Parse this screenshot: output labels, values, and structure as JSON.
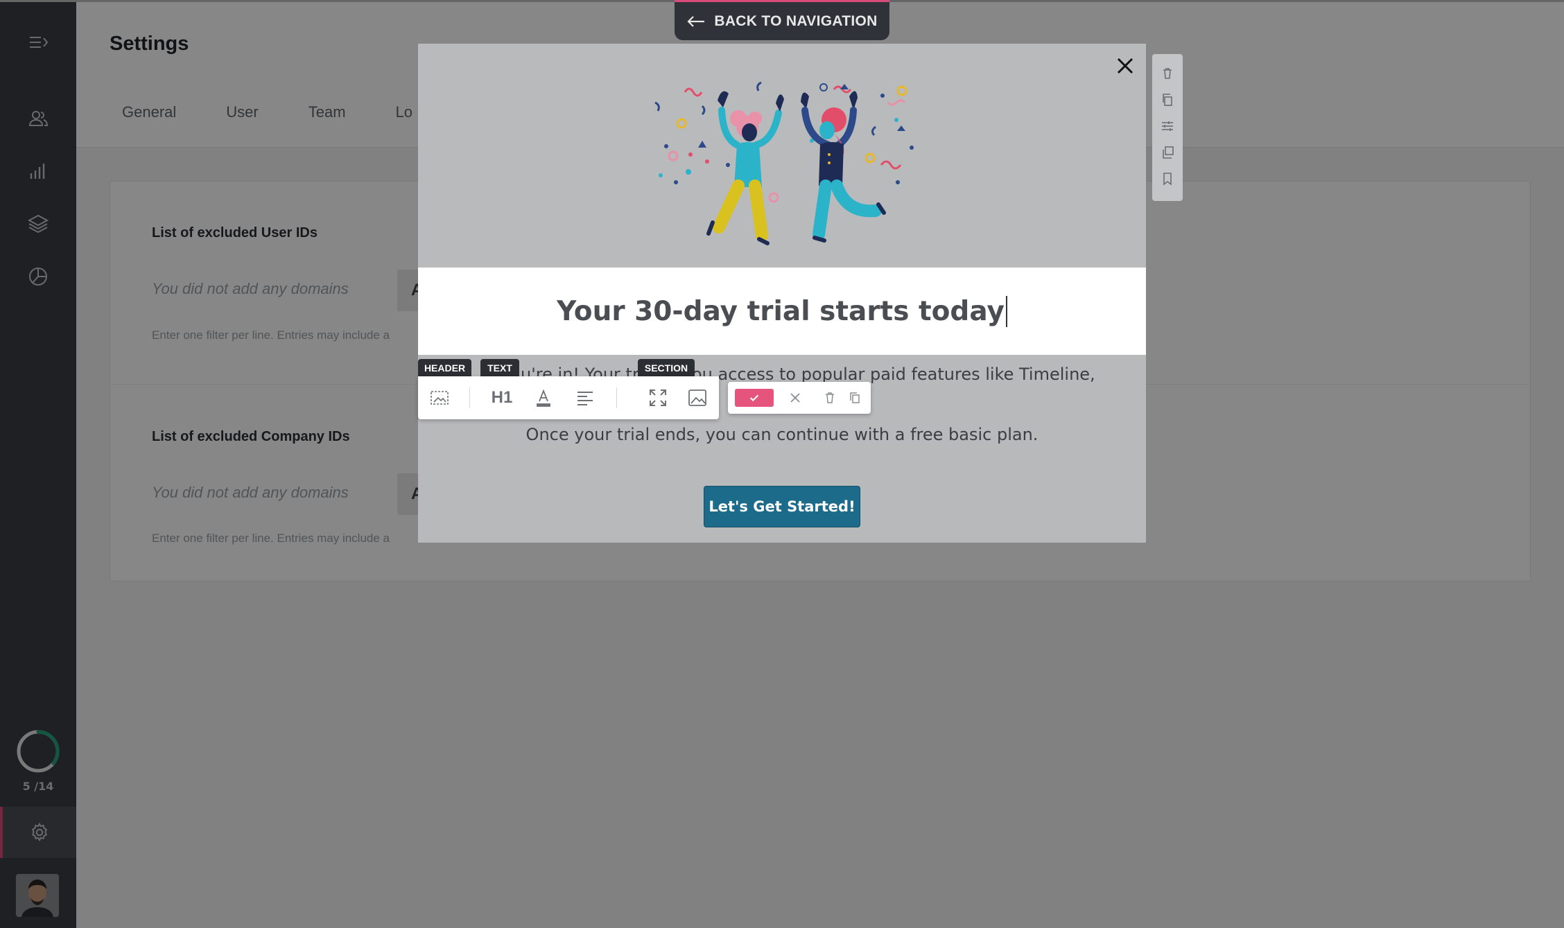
{
  "page": {
    "title": "Settings",
    "tabs": [
      "General",
      "User",
      "Team",
      "Lo"
    ],
    "sections": [
      {
        "label": "List of excluded User IDs",
        "placeholder": "You did not add any domains",
        "add_label": "Add",
        "hint": "Enter one filter per line. Entries may include a"
      },
      {
        "label": "List of excluded Company IDs",
        "placeholder": "You did not add any domains",
        "add_label": "Add",
        "hint": "Enter one filter per line. Entries may include a"
      }
    ]
  },
  "sidebar": {
    "icons": [
      "menu-expand-icon",
      "users-icon",
      "analytics-icon",
      "layers-icon",
      "chart-pie-icon",
      "gear-icon"
    ],
    "progress": {
      "text": "5 /14",
      "done": 5,
      "total": 14
    },
    "accent_color": "#d94b7a"
  },
  "back_nav": {
    "label": "BACK TO NAVIGATION"
  },
  "modal": {
    "heading": "Your 30-day trial starts today",
    "body_line_1": "You're in! Your trial gives you access to popular paid features like Timeline,",
    "body_line_1_visible_left": "u're in! Your tria",
    "body_line_1_visible_right": "ou access to popular paid features like Timeline,",
    "body_line_2": "Once your trial ends, you can continue with a free basic plan.",
    "cta_label": "Let's Get Started!",
    "cta_color": "#1c6b8a"
  },
  "editor": {
    "tags": [
      "HEADER",
      "TEXT",
      "SECTION"
    ],
    "heading_level": "H1",
    "confirm_color": "#e4547d"
  }
}
